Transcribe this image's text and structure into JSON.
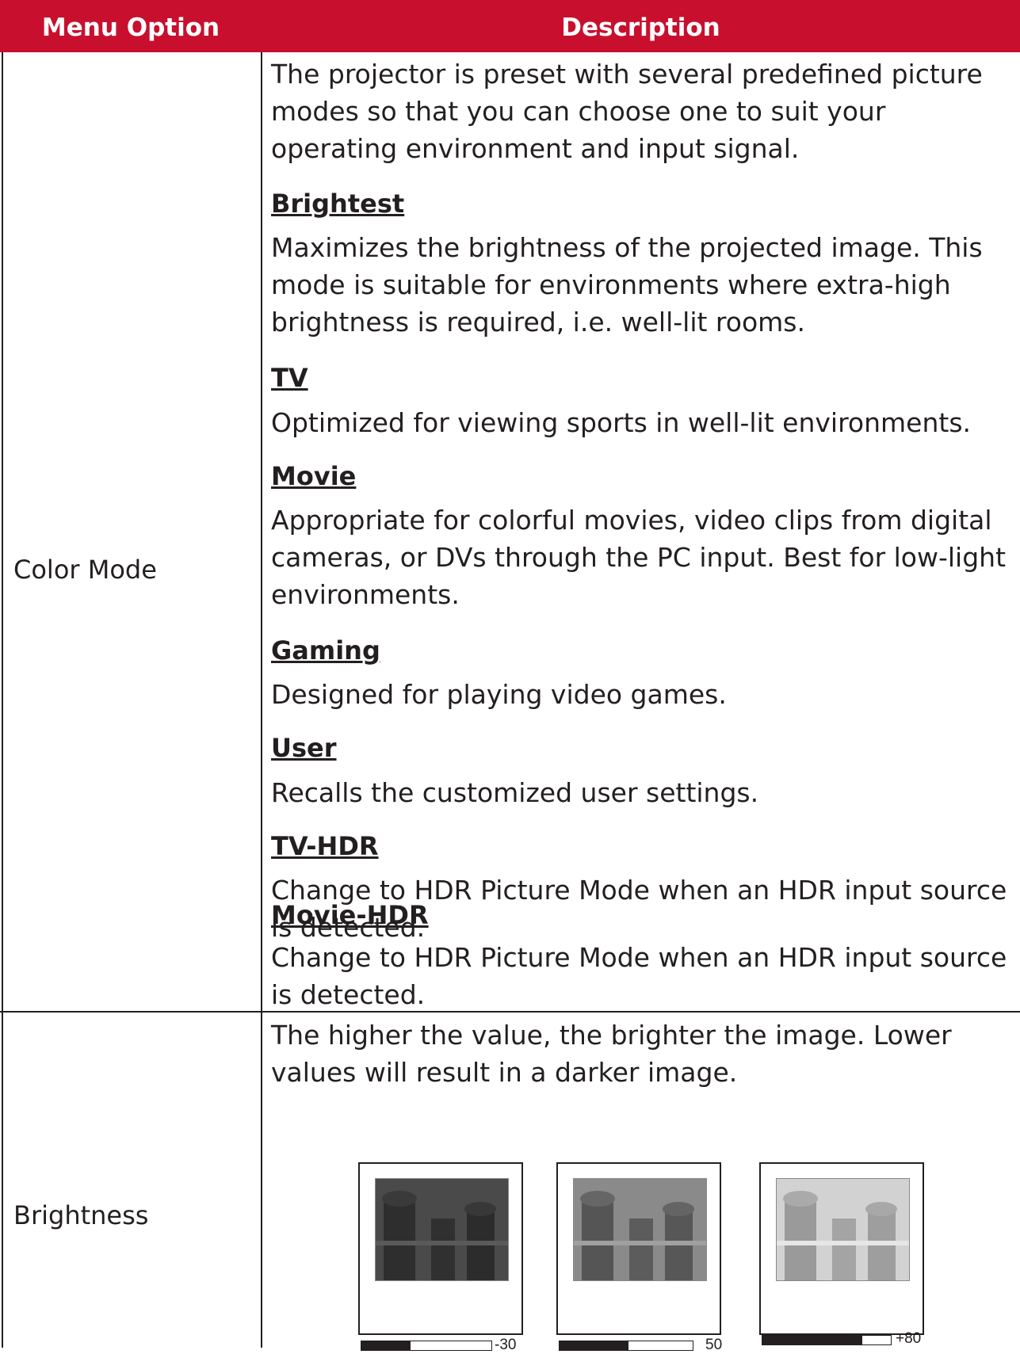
{
  "header": {
    "col1": "Menu Option",
    "col2": "Description"
  },
  "color_mode": {
    "option": "Color Mode",
    "intro": "The projector is preset with several predefined picture modes so that you can choose one to suit your operating environment and input signal.",
    "modes": [
      {
        "title": "Brightest",
        "text": "Maximizes the brightness of the projected image. This mode is suitable for environments where extra-high brightness is required, i.e. well-lit rooms."
      },
      {
        "title": "TV",
        "text": "Optimized for viewing sports in well-lit environments."
      },
      {
        "title": "Movie",
        "text": "Appropriate for colorful movies, video clips from digital cameras, or DVs through the PC input. Best for low-light environments."
      },
      {
        "title": "Gaming",
        "text": "Designed for playing video games."
      },
      {
        "title": "User",
        "text": "Recalls the customized user settings."
      },
      {
        "title": "TV-HDR",
        "text": "Change to HDR Picture Mode when an HDR input source is detected."
      },
      {
        "title": "Movie-HDR",
        "text": "Change to HDR Picture Mode when an HDR input source is detected."
      }
    ]
  },
  "brightness": {
    "option": "Brightness",
    "text": "The higher the value, the brighter the image. Lower values will result in a darker image.",
    "examples": [
      {
        "label": "-30",
        "level": 0.38
      },
      {
        "label": "50",
        "level": 0.52
      },
      {
        "label": "+80",
        "level": 0.78
      }
    ]
  },
  "colors": {
    "header_bg": "#c8102e",
    "text": "#231f20"
  }
}
